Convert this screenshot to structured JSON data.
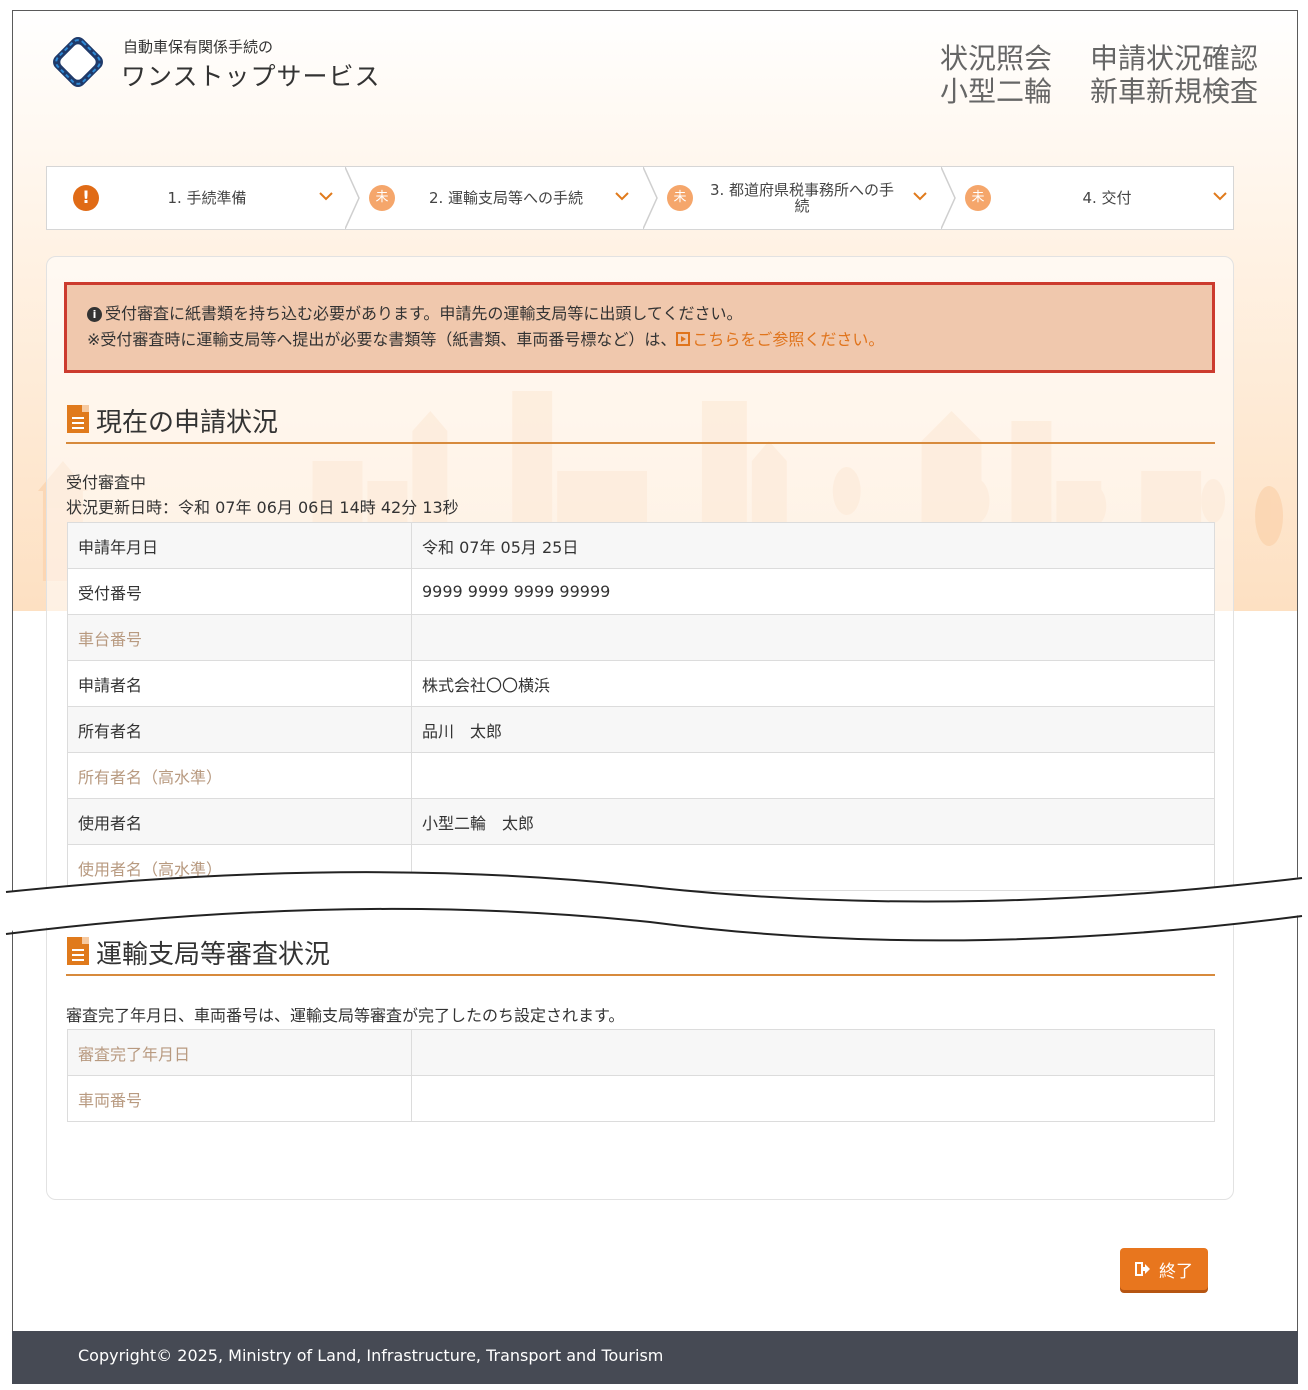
{
  "header": {
    "logo_small": "自動車保有関係手続の",
    "logo_big": "ワンストップサービス",
    "title_rows": [
      [
        "状況照会",
        "申請状況確認"
      ],
      [
        "小型二輪",
        "新車新規検査"
      ]
    ]
  },
  "steps": [
    {
      "icon": "!",
      "label": "1. 手続準備",
      "status": "warning"
    },
    {
      "icon": "未",
      "label": "2. 運輸支局等への手続",
      "status": "pending"
    },
    {
      "icon": "未",
      "label": "3. 都道府県税事務所への手続",
      "status": "pending"
    },
    {
      "icon": "未",
      "label": "4. 交付",
      "status": "pending"
    }
  ],
  "alert": {
    "line1": "受付審査に紙書類を持ち込む必要があります。申請先の運輸支局等に出頭してください。",
    "line2": "※受付審査時に運輸支局等へ提出が必要な書類等（紙書類、車両番号標など）は、",
    "link": "こちらをご参照ください。"
  },
  "current": {
    "title": "現在の申請状況",
    "status": "受付審査中",
    "updated": "状況更新日時：令和 07年 06月 06日 14時 42分 13秒",
    "rows": [
      {
        "key": "申請年月日",
        "value": "令和 07年 05月 25日",
        "dim": false
      },
      {
        "key": "受付番号",
        "value": "9999 9999 9999 99999",
        "dim": false
      },
      {
        "key": "車台番号",
        "value": "",
        "dim": true
      },
      {
        "key": "申請者名",
        "value": "株式会社〇〇横浜",
        "dim": false
      },
      {
        "key": "所有者名",
        "value": "品川　太郎",
        "dim": false
      },
      {
        "key": "所有者名（高水準）",
        "value": "",
        "dim": true
      },
      {
        "key": "使用者名",
        "value": "小型二輪　太郎",
        "dim": false
      },
      {
        "key": "使用者名（高水準）",
        "value": "",
        "dim": true
      }
    ]
  },
  "review": {
    "title": "運輸支局等審査状況",
    "note": "審査完了年月日、車両番号は、運輸支局等審査が完了したのち設定されます。",
    "rows": [
      {
        "key": "審査完了年月日",
        "value": "",
        "dim": true
      },
      {
        "key": "車両番号",
        "value": "",
        "dim": true
      }
    ]
  },
  "end_button": "終了",
  "footer": "Copyright© 2025, Ministry of Land, Infrastructure, Transport and Tourism",
  "colors": {
    "accent": "#e8761e",
    "alert_border": "#cc3b2e",
    "alert_bg": "#f0c8ad",
    "footer_bg": "#464a54"
  }
}
